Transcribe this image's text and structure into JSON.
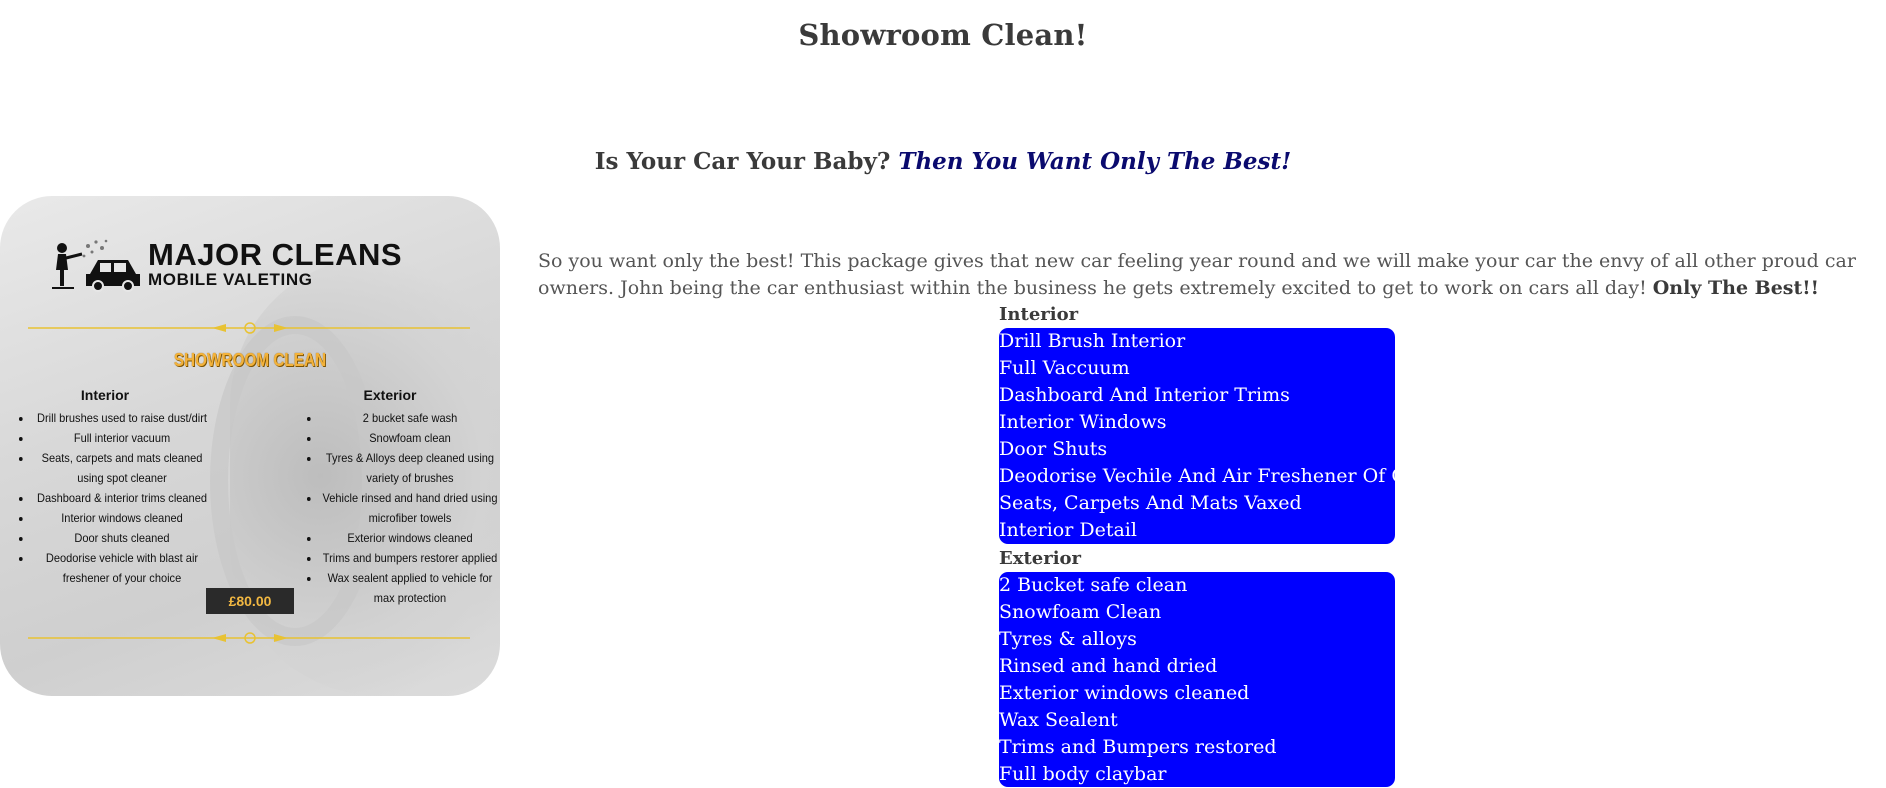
{
  "header": {
    "title": "Showroom Clean!"
  },
  "tagline": {
    "lead": "Is Your Car Your Baby? ",
    "emphasis": "Then You Want Only The Best!"
  },
  "promo_image": {
    "brand_line_1": "MAJOR CLEANS",
    "brand_line_2": "MOBILE VALETING",
    "package_name": "SHOWROOM CLEAN",
    "interior_title": "Interior",
    "exterior_title": "Exterior",
    "interior_items": [
      "Drill brushes used to raise dust/dirt",
      "Full interior vacuum",
      "Seats, carpets and mats cleaned using spot cleaner",
      "Dashboard & interior trims cleaned",
      "Interior windows cleaned",
      "Door shuts cleaned",
      "Deodorise vehicle with blast air freshener of your choice"
    ],
    "exterior_items": [
      "2 bucket safe wash",
      "Snowfoam clean",
      "Tyres & Alloys deep cleaned using variety of brushes",
      "Vehicle rinsed and hand dried using microfiber towels",
      "Exterior windows cleaned",
      "Trims and bumpers restorer applied",
      "Wax sealent applied to vehicle for max protection"
    ],
    "price": "£80.00",
    "accent_color": "#f3b23a"
  },
  "description": {
    "text": "So you want only the best! This package gives that new car feeling year round and we will make your car the envy of all other proud car owners. John being the car enthusiast within the business he gets extremely excited to get to work on cars all day! ",
    "strong": "Only The Best!!"
  },
  "interior": {
    "heading": "Interior",
    "items": [
      "Drill Brush Interior",
      "Full Vaccuum",
      "Dashboard And Interior Trims",
      "Interior Windows",
      "Door Shuts",
      "Deodorise Vechile And Air Freshener Of Choice",
      "Seats, Carpets And Mats Vaxed",
      "Interior Detail"
    ]
  },
  "exterior": {
    "heading": "Exterior",
    "items": [
      "2 Bucket safe clean",
      "Snowfoam Clean",
      "Tyres & alloys",
      "Rinsed and hand dried",
      "Exterior windows cleaned",
      "Wax Sealent",
      "Trims and Bumpers restored",
      "Full body claybar"
    ]
  },
  "colors": {
    "list_box_bg": "#0000ff",
    "tagline_emphasis": "#0a0a6e"
  }
}
